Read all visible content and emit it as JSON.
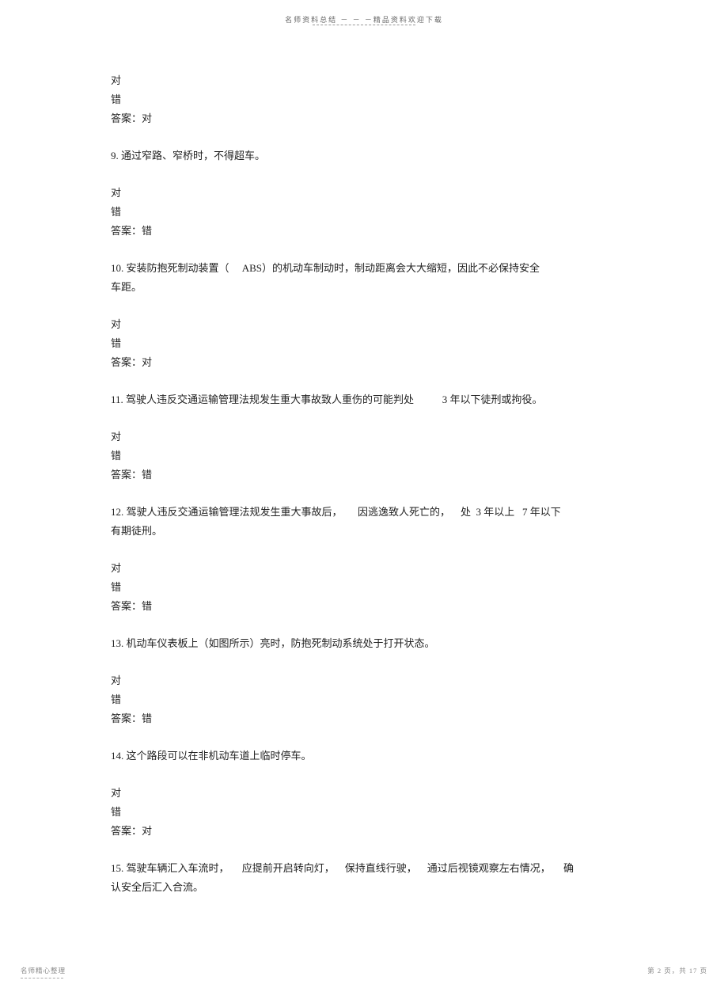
{
  "header": "名师资料总结   －  －  －精品资料欢迎下载",
  "footer_left": "名师精心整理",
  "footer_right": "第  2  页，共  17  页",
  "questions": [
    {
      "prefix_choices": [
        "对",
        "错"
      ],
      "prefix_answer": "答案：对",
      "number": "9.",
      "text": " 通过窄路、窄桥时，不得超车。",
      "choices": [
        "对",
        "错"
      ],
      "answer": "答案：错"
    },
    {
      "number": "10.",
      "text": " 安装防抱死制动装置（     ABS）的机动车制动时，制动距离会大大缩短，因此不必保持安全",
      "text2": "车距。",
      "choices": [
        "对",
        "错"
      ],
      "answer": "答案：对"
    },
    {
      "number": "11.",
      "text": " 驾驶人违反交通运输管理法规发生重大事故致人重伤的可能判处           3 年以下徒刑或拘役。",
      "choices": [
        "对",
        "错"
      ],
      "answer": "答案：错"
    },
    {
      "number": "12.",
      "text": " 驾驶人违反交通运输管理法规发生重大事故后，      因逃逸致人死亡的，    处  3 年以上   7 年以下",
      "text2": "有期徒刑。",
      "choices": [
        "对",
        "错"
      ],
      "answer": "答案：错"
    },
    {
      "number": "13.",
      "text": " 机动车仪表板上（如图所示）亮时，防抱死制动系统处于打开状态。",
      "choices": [
        "对",
        "错"
      ],
      "answer": "答案：错"
    },
    {
      "number": "14.",
      "text": " 这个路段可以在非机动车道上临时停车。",
      "choices": [
        "对",
        "错"
      ],
      "answer": "答案：对"
    },
    {
      "number": "15.",
      "text": " 驾驶车辆汇入车流时，     应提前开启转向灯，    保持直线行驶，    通过后视镜观察左右情况，     确",
      "text2": "认安全后汇入合流。"
    }
  ]
}
